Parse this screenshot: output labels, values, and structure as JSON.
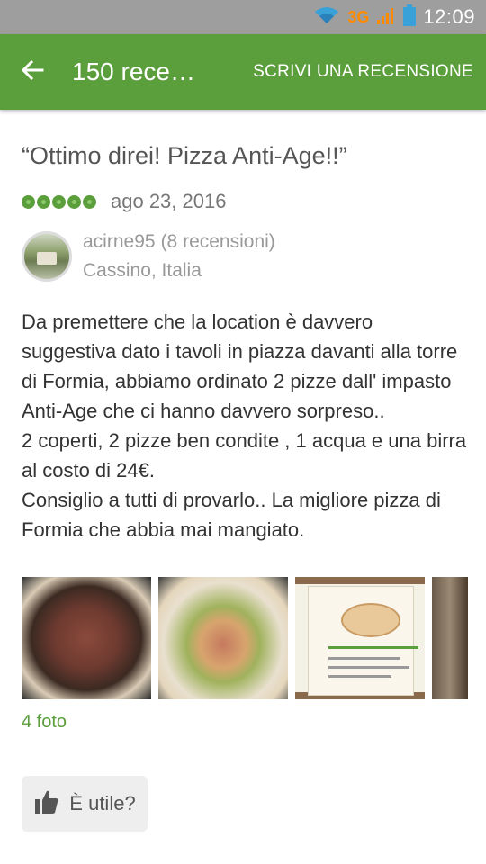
{
  "status_bar": {
    "network": "3G",
    "time": "12:09"
  },
  "app_bar": {
    "title": "150 rece…",
    "write_review": "SCRIVI UNA RECENSIONE"
  },
  "review": {
    "title": "“Ottimo direi! Pizza Anti-Age!!”",
    "rating": 5,
    "date": "ago 23, 2016",
    "author": {
      "name": "acirne95",
      "reviews": "(8 recensioni)",
      "location": "Cassino, Italia"
    },
    "body": "Da premettere che la location è davvero suggestiva dato i tavoli in piazza davanti alla torre di Formia, abbiamo ordinato 2 pizze dall' impasto Anti-Age che ci hanno davvero sorpreso..\n2 coperti, 2 pizze ben condite , 1 acqua e una birra al costo di 24€.\nConsiglio a tutti di provarlo.. La migliore pizza di Formia che abbia mai mangiato.",
    "photo_count": "4 foto",
    "helpful_label": "È utile?"
  },
  "colors": {
    "brand_green": "#5b9e3c",
    "status_bar": "#9e9e9e",
    "network_orange": "#ff8a00"
  },
  "icons": [
    "wifi-icon",
    "signal-icon",
    "battery-icon",
    "back-arrow-icon",
    "rating-bubble-icon",
    "thumbs-up-icon"
  ]
}
